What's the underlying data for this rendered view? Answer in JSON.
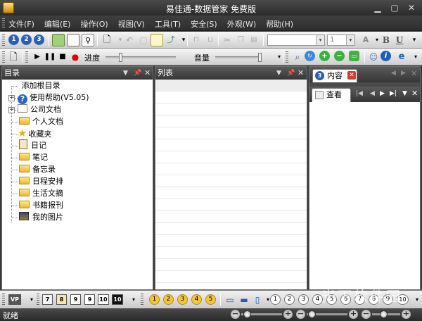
{
  "window": {
    "title": "易佳通-数据管家 免费版"
  },
  "menubar": {
    "items": [
      "文件(F)",
      "编辑(E)",
      "操作(O)",
      "视图(V)",
      "工具(T)",
      "安全(S)",
      "外观(W)",
      "帮助(H)"
    ]
  },
  "toolbar1": {
    "font_size_value": "1",
    "bold_label": "B",
    "underline_label": "U"
  },
  "toolbar2": {
    "progress_label": "进度",
    "volume_label": "音量"
  },
  "tree_pane": {
    "title": "目录",
    "items": [
      {
        "label": "添加根目录",
        "icon": "document-icon"
      },
      {
        "label": "使用帮助(V5.05)",
        "icon": "help-icon"
      },
      {
        "label": "公司文档",
        "icon": "pen-document-icon"
      },
      {
        "label": "个人文档",
        "icon": "folder-icon"
      },
      {
        "label": "收藏夹",
        "icon": "star-icon"
      },
      {
        "label": "日记",
        "icon": "clipboard-icon"
      },
      {
        "label": "笔记",
        "icon": "folder-icon"
      },
      {
        "label": "备忘录",
        "icon": "folder-icon"
      },
      {
        "label": "日程安排",
        "icon": "folder-icon"
      },
      {
        "label": "生活文摘",
        "icon": "folder-icon"
      },
      {
        "label": "书籍报刊",
        "icon": "folder-icon"
      },
      {
        "label": "我的图片",
        "icon": "picture-icon"
      }
    ]
  },
  "list_pane": {
    "title": "列表"
  },
  "content_pane": {
    "tab_label": "内容",
    "view_tab_label": "查看"
  },
  "bottom_toolbar": {
    "zoom_buttons": [
      "7",
      "8",
      "9",
      "9",
      "10",
      "10"
    ],
    "circle_numbers": [
      "1",
      "2",
      "3",
      "4",
      "5"
    ],
    "number_buttons": [
      "1",
      "2",
      "3",
      "4",
      "5",
      "6",
      "7",
      "8",
      "9",
      "10"
    ]
  },
  "statusbar": {
    "status_text": "就绪"
  },
  "watermark": {
    "text": "光下软件园"
  },
  "colors": {
    "dark_chrome": "#2e2e2e",
    "toolbar_light": "#e6e6e6",
    "accent_blue": "#1d5fb8"
  }
}
